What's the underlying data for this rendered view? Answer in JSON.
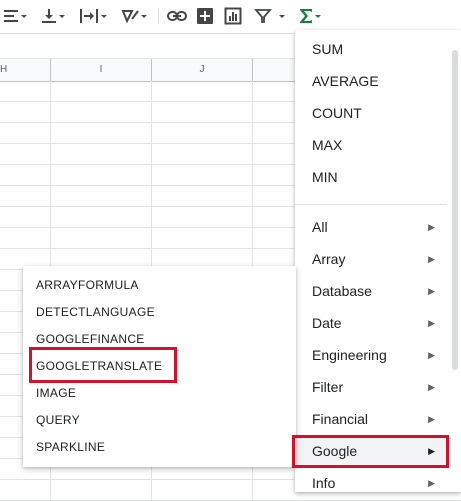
{
  "toolbar": {
    "tools": [
      "align-left-icon",
      "vertical-align-icon",
      "text-wrap-icon",
      "text-rotate-icon",
      "link-icon",
      "insert-comment-icon",
      "insert-chart-icon",
      "filter-icon",
      "functions-icon"
    ]
  },
  "columns": [
    "H",
    "I",
    "J"
  ],
  "function_menu": {
    "basic": [
      "SUM",
      "AVERAGE",
      "COUNT",
      "MAX",
      "MIN"
    ],
    "categories": [
      "All",
      "Array",
      "Database",
      "Date",
      "Engineering",
      "Filter",
      "Financial",
      "Google",
      "Info"
    ],
    "highlighted": "Google",
    "arrow_glyph": "▶"
  },
  "submenu": {
    "items": [
      "ARRAYFORMULA",
      "DETECTLANGUAGE",
      "GOOGLEFINANCE",
      "GOOGLETRANSLATE",
      "IMAGE",
      "QUERY",
      "SPARKLINE"
    ],
    "highlighted": "GOOGLETRANSLATE"
  },
  "colors": {
    "accent": "#188038",
    "annotation": "#d3112a",
    "icon": "#444746"
  }
}
